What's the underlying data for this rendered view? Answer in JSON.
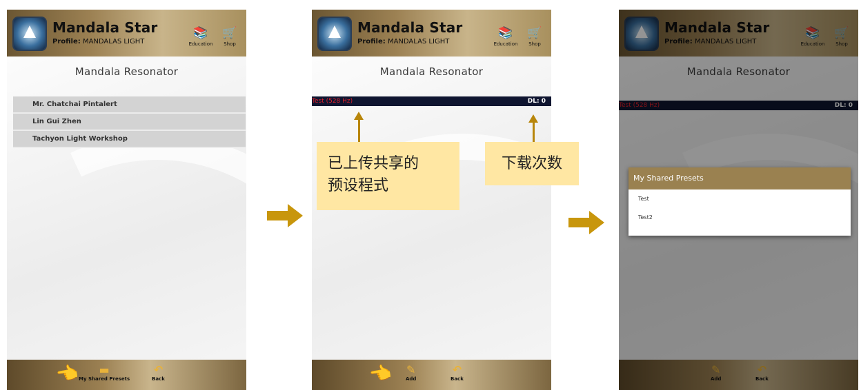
{
  "app": {
    "title": "Mandala Star",
    "profile_label": "Profile:",
    "profile_value": "MANDALAS LIGHT",
    "education_label": "Education",
    "shop_label": "Shop"
  },
  "page_title": "Mandala Resonator",
  "screen1": {
    "list": [
      "Mr. Chatchai Pintalert",
      "Lin Gui Zhen",
      "Tachyon Light Workshop"
    ],
    "footer": {
      "shared_label": "My Shared Presets",
      "back_label": "Back"
    }
  },
  "screen2": {
    "preset_name": "Test (528 Hz)",
    "download_count": "DL: 0",
    "footer": {
      "add_label": "Add",
      "back_label": "Back"
    }
  },
  "screen3": {
    "preset_name": "Test (528 Hz)",
    "download_count": "DL: 0",
    "dialog": {
      "title": "My Shared Presets",
      "items": [
        "Test",
        "Test2"
      ]
    },
    "footer": {
      "add_label": "Add",
      "back_label": "Back"
    }
  },
  "annotations": {
    "uploaded_presets": "已上传共享的\n预设程式",
    "uploaded_line1": "已上传共享的",
    "uploaded_line2": "预设程式",
    "download_count": "下载次数"
  },
  "colors": {
    "header_gold": "#9c8153",
    "preset_bar": "#0f1530",
    "preset_name": "#e0202a",
    "arrow": "#c8960c",
    "callout": "#ffe7a3"
  },
  "icons": {
    "education": "books-icon",
    "shop": "cart-icon",
    "shared": "folder-icon",
    "add": "pencil-icon",
    "back": "back-arrow-icon",
    "hand": "pointing-hand-icon"
  }
}
